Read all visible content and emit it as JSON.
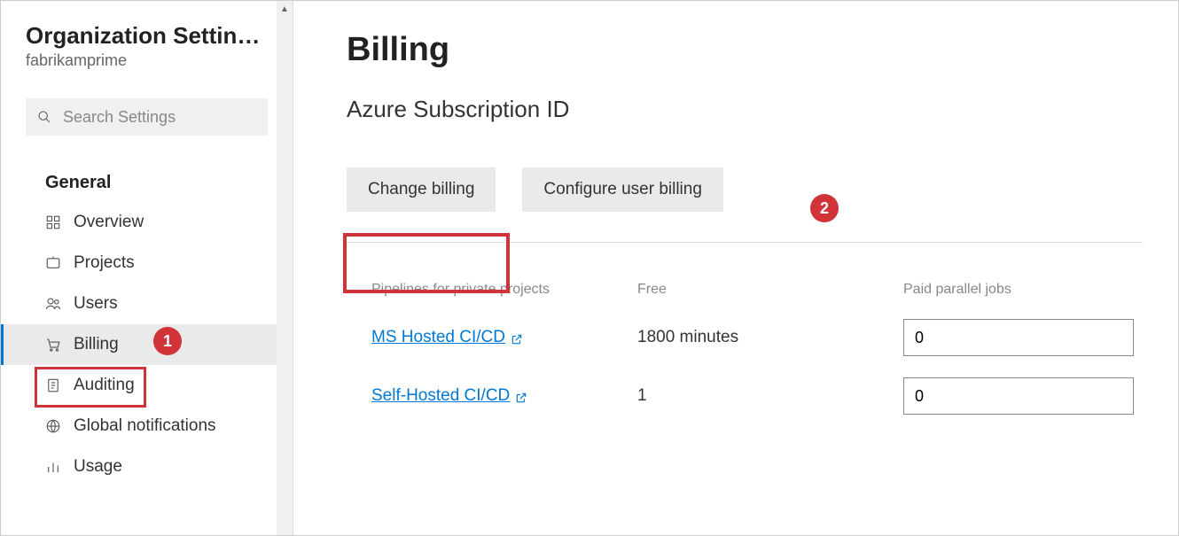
{
  "sidebar": {
    "title": "Organization Settin…",
    "subtitle": "fabrikamprime",
    "search_placeholder": "Search Settings",
    "section_label": "General",
    "items": [
      {
        "label": "Overview",
        "icon": "overview"
      },
      {
        "label": "Projects",
        "icon": "projects"
      },
      {
        "label": "Users",
        "icon": "users"
      },
      {
        "label": "Billing",
        "icon": "billing",
        "active": true
      },
      {
        "label": "Auditing",
        "icon": "auditing"
      },
      {
        "label": "Global notifications",
        "icon": "notifications"
      },
      {
        "label": "Usage",
        "icon": "usage"
      }
    ]
  },
  "main": {
    "title": "Billing",
    "subtitle": "Azure Subscription ID",
    "change_billing_label": "Change billing",
    "configure_user_billing_label": "Configure user billing",
    "table": {
      "headers": {
        "col0": "Pipelines for private projects",
        "col1": "Free",
        "col2": "Paid parallel jobs"
      },
      "rows": [
        {
          "name": "MS Hosted CI/CD",
          "free": "1800 minutes",
          "paid": "0"
        },
        {
          "name": "Self-Hosted CI/CD",
          "free": "1",
          "paid": "0"
        }
      ]
    }
  },
  "callouts": {
    "one": "1",
    "two": "2"
  }
}
